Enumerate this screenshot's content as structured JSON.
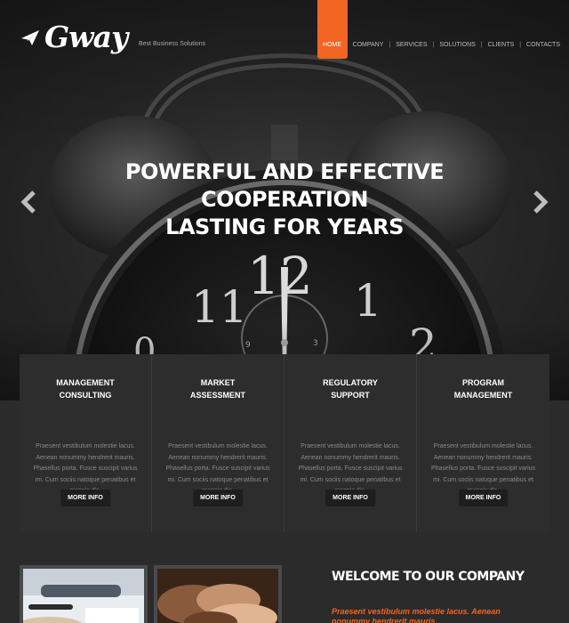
{
  "brand": {
    "name": "Gway",
    "tagline": "Best Business Solutions",
    "accent_color": "#f26522",
    "logo_icon": "paper-plane-icon"
  },
  "nav": {
    "items": [
      {
        "label": "HOME",
        "active": true
      },
      {
        "label": "COMPANY",
        "active": false
      },
      {
        "label": "SERVICES",
        "active": false
      },
      {
        "label": "SOLUTIONS",
        "active": false
      },
      {
        "label": "CLIENTS",
        "active": false
      },
      {
        "label": "CONTACTS",
        "active": false
      }
    ]
  },
  "hero": {
    "title_lines": [
      "POWERFUL AND EFFECTIVE",
      "COOPERATION",
      "LASTING FOR YEARS"
    ],
    "prev_icon": "chevron-left-icon",
    "next_icon": "chevron-right-icon"
  },
  "services": [
    {
      "title_lines": [
        "MANAGEMENT",
        "CONSULTING"
      ],
      "text": "Praesent vestibulum molestie lacus. Aenean nonummy hendrerit mauris. Phasellus porta. Fusce suscipit varius mi. Cum sociis natoque penatibus et magnis dis.",
      "button": "MORE INFO"
    },
    {
      "title_lines": [
        "MARKET",
        "ASSESSMENT"
      ],
      "text": "Praesent vestibulum molestie lacus. Aenean nonummy hendrerit mauris. Phasellus porta. Fusce suscipit varius mi. Cum sociis natoque penatibus et magnis dis.",
      "button": "MORE INFO"
    },
    {
      "title_lines": [
        "REGULATORY",
        "SUPPORT"
      ],
      "text": "Praesent vestibulum molestie lacus. Aenean nonummy hendrerit mauris. Phasellus porta. Fusce suscipit varius mi. Cum sociis natoque penatibus et magnis dis.",
      "button": "MORE INFO"
    },
    {
      "title_lines": [
        "PROGRAM",
        "MANAGEMENT"
      ],
      "text": "Praesent vestibulum molestie lacus. Aenean nonummy hendrerit mauris. Phasellus porta. Fusce suscipit varius mi. Cum sociis natoque penatibus et magnis dis.",
      "button": "MORE INFO"
    }
  ],
  "welcome": {
    "title": "WELCOME TO OUR COMPANY",
    "text": "Praesent vestibulum molestie lacus. Aenean nonummy hendrerit mauris."
  }
}
